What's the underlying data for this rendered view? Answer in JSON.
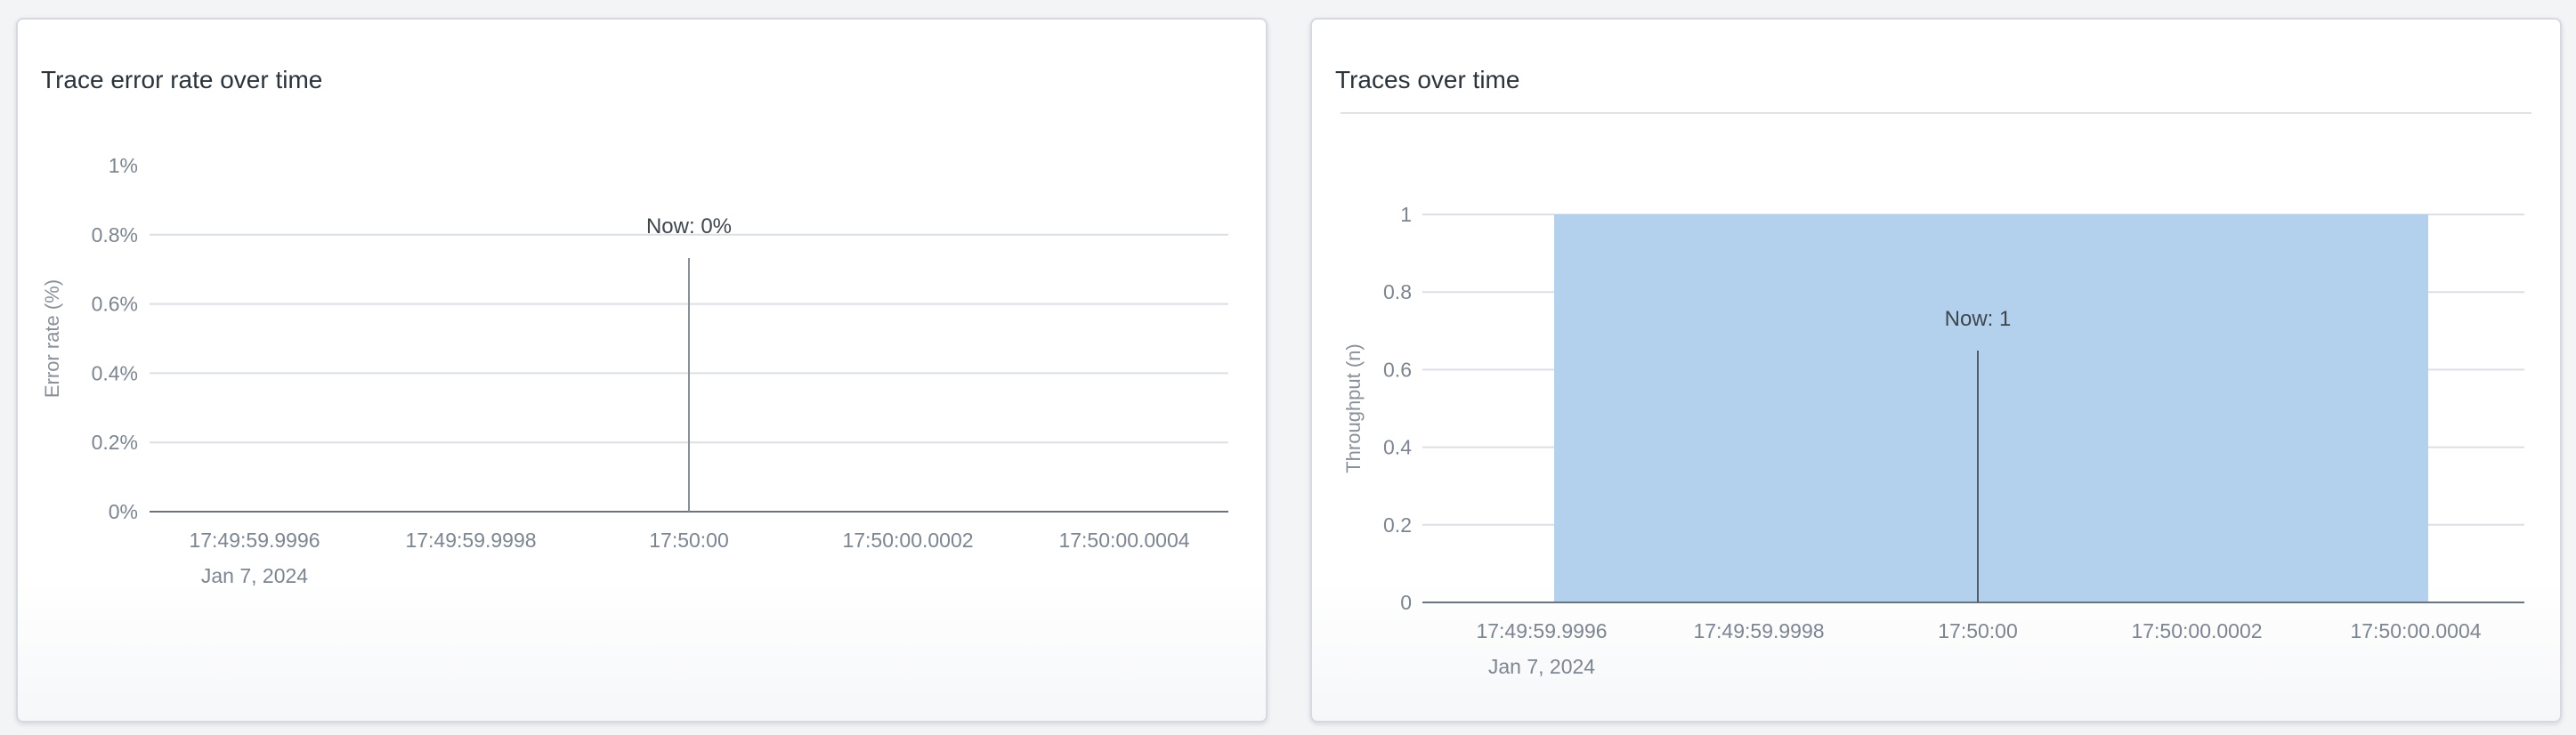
{
  "chart_data": [
    {
      "type": "line",
      "title": "Trace error rate over time",
      "xlabel": "",
      "ylabel": "Error rate (%)",
      "x": [
        "17:49:59.9996",
        "17:49:59.9998",
        "17:50:00",
        "17:50:00.0002",
        "17:50:00.0004"
      ],
      "x_sublabel": "Jan 7, 2024",
      "yticks": [
        "0%",
        "0.2%",
        "0.4%",
        "0.6%",
        "0.8%",
        "1%"
      ],
      "ylim": [
        0,
        1
      ],
      "series": [
        {
          "values": [
            0,
            0,
            0,
            0,
            0
          ]
        }
      ],
      "annotation": {
        "text": "Now: 0%",
        "x": "17:50:00"
      },
      "grid": true,
      "colors": {
        "line": "#6b7280",
        "grid": "#dcdfe3",
        "marker": "#8a8f96"
      }
    },
    {
      "type": "area",
      "title": "Traces over time",
      "xlabel": "",
      "ylabel": "Throughput (n)",
      "x": [
        "17:49:59.9996",
        "17:49:59.9998",
        "17:50:00",
        "17:50:00.0002",
        "17:50:00.0004"
      ],
      "x_sublabel": "Jan 7, 2024",
      "yticks": [
        "0",
        "0.2",
        "0.4",
        "0.6",
        "0.8",
        "1"
      ],
      "ylim": [
        0,
        1
      ],
      "series": [
        {
          "values": [
            1,
            1,
            1,
            1,
            1
          ]
        }
      ],
      "annotation": {
        "text": "Now: 1",
        "x": "17:50:00"
      },
      "grid": true,
      "colors": {
        "fill": "#b3d1ec",
        "line": "#6b7280",
        "grid": "#dcdfe3",
        "marker": "#555b62"
      }
    }
  ]
}
